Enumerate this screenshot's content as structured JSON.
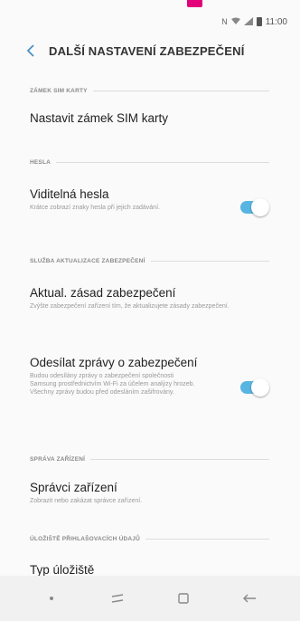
{
  "status_bar": {
    "time": "11:00",
    "icons": [
      "nfc-icon",
      "wifi-icon",
      "signal-icon",
      "battery-icon"
    ]
  },
  "header": {
    "back_icon": "chevron-left-icon",
    "title": "DALŠÍ NASTAVENÍ ZABEZPEČENÍ"
  },
  "sections": {
    "sim_lock": {
      "header": "ZÁMEK SIM KARTY",
      "item_title": "Nastavit zámek SIM karty"
    },
    "passwords": {
      "header": "HESLA",
      "item_title": "Viditelná hesla",
      "item_sub": "Krátce zobrazí znaky hesla při jejich zadávání.",
      "toggle_on": true
    },
    "security_updates": {
      "header": "SLUŽBA AKTUALIZACE ZABEZPEČENÍ",
      "policy_title": "Aktual. zásad zabezpečení",
      "policy_sub": "Zvýšte zabezpečení zařízení tím, že aktualizujete zásady zabezpečení.",
      "reports_title": "Odesílat zprávy o zabezpečení",
      "reports_sub": "Budou odesílány zprávy o zabezpečení společnosti Samsung prostřednictvím Wi-Fi za účelem analýzy hrozeb. Všechny zprávy budou před odesláním zašifrovány.",
      "reports_toggle_on": true
    },
    "device_admin": {
      "header": "SPRÁVA ZAŘÍZENÍ",
      "item_title": "Správci zařízení",
      "item_sub": "Zobrazit nebo zakázat správce zařízení."
    },
    "credential_storage": {
      "header": "ÚLOŽIŠTĚ PŘIHLAŠOVACÍCH ÚDAJŮ",
      "item_title": "Typ úložiště"
    }
  },
  "navbar": {
    "icons": [
      "dot-icon",
      "recent-apps-icon",
      "home-icon",
      "back-arrow-icon"
    ]
  },
  "colors": {
    "accent": "#58b5e2",
    "back_chevron": "#4a90c8",
    "brand_magenta": "#e2007a"
  }
}
